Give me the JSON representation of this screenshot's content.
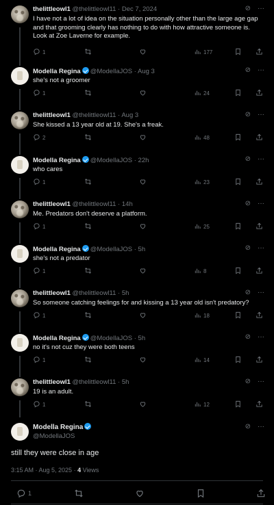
{
  "tweets": [
    {
      "name": "thelittleowl1",
      "handle": "@thelittleowl11",
      "time": "Dec 7, 2024",
      "verified": false,
      "avatar": "owl",
      "text": "I have not a lot of idea on the situation personally other than the large age gap and that grooming clearly has nothing to do with how attractive someone is. Look at Zoe Laverne for example.",
      "replies": "1",
      "views": "177"
    },
    {
      "name": "Modella Regina",
      "handle": "@ModellaJOS",
      "time": "Aug 3",
      "verified": true,
      "avatar": "mod",
      "text": "she's not a groomer",
      "replies": "1",
      "views": "24"
    },
    {
      "name": "thelittleowl1",
      "handle": "@thelittleowl11",
      "time": "Aug 3",
      "verified": false,
      "avatar": "owl",
      "text": "She kissed a 13 year old at 19. She's a freak.",
      "replies": "2",
      "views": "48"
    },
    {
      "name": "Modella Regina",
      "handle": "@ModellaJOS",
      "time": "22h",
      "verified": true,
      "avatar": "mod",
      "text": "who cares",
      "replies": "1",
      "views": "23"
    },
    {
      "name": "thelittleowl1",
      "handle": "@thelittleowl11",
      "time": "14h",
      "verified": false,
      "avatar": "owl",
      "text": "Me. Predators don't deserve a platform.",
      "replies": "1",
      "views": "25"
    },
    {
      "name": "Modella Regina",
      "handle": "@ModellaJOS",
      "time": "5h",
      "verified": true,
      "avatar": "mod",
      "text": "she's not a predator",
      "replies": "1",
      "views": "8"
    },
    {
      "name": "thelittleowl1",
      "handle": "@thelittleowl11",
      "time": "5h",
      "verified": false,
      "avatar": "owl",
      "text": "So someone catching feelings for and kissing a 13 year old isn't predatory?",
      "replies": "1",
      "views": "18"
    },
    {
      "name": "Modella Regina",
      "handle": "@ModellaJOS",
      "time": "5h",
      "verified": true,
      "avatar": "mod",
      "text": "no it's not cuz they were both teens",
      "replies": "1",
      "views": "14"
    },
    {
      "name": "thelittleowl1",
      "handle": "@thelittleowl11",
      "time": "5h",
      "verified": false,
      "avatar": "owl",
      "text": "19 is an adult.",
      "replies": "1",
      "views": "12"
    }
  ],
  "main_tweet": {
    "name": "Modella Regina",
    "handle": "@ModellaJOS",
    "verified": true,
    "text": "still they were close in age",
    "timestamp": "3:15 AM · Aug 5, 2025 · ",
    "views_count": "4",
    "views_label": " Views",
    "replies": "1"
  },
  "colors": {
    "background": "#000000",
    "text": "#e7e9ea",
    "muted": "#71767b",
    "verified": "#1d9bf0",
    "divider": "#2f3336"
  }
}
